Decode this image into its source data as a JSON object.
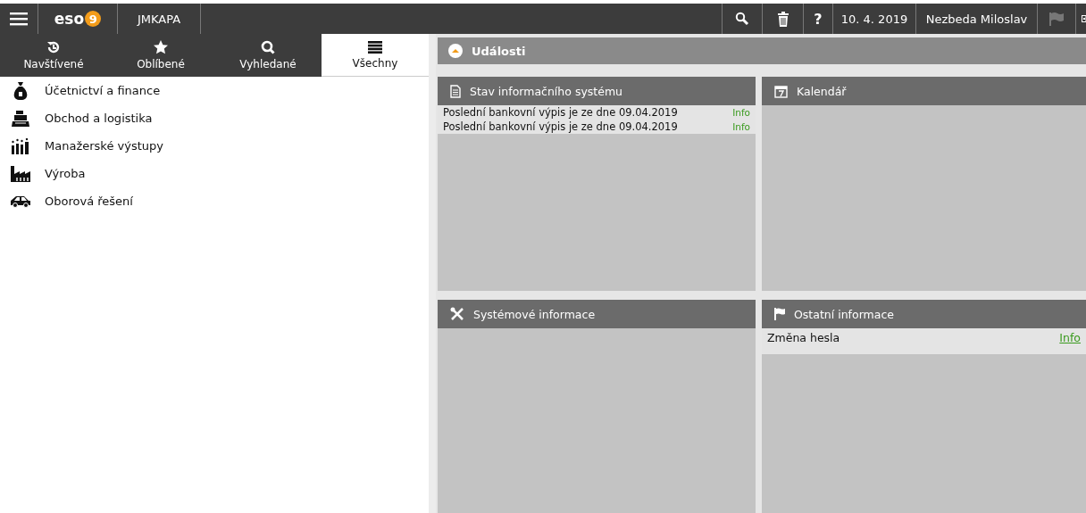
{
  "topbar": {
    "logo": {
      "text": "eso",
      "badge": "9"
    },
    "company": "JMKAPA",
    "help": "?",
    "date": "10. 4. 2019",
    "user": "Nezbeda Miloslav"
  },
  "tabs": [
    {
      "label": "Navštívené",
      "selected": false
    },
    {
      "label": "Oblíbené",
      "selected": false
    },
    {
      "label": "Vyhledané",
      "selected": false
    },
    {
      "label": "Všechny",
      "selected": true
    }
  ],
  "menu": [
    {
      "label": "Účetnictví a finance"
    },
    {
      "label": "Obchod a logistika"
    },
    {
      "label": "Manažerské výstupy"
    },
    {
      "label": "Výroba"
    },
    {
      "label": "Oborová řešení"
    }
  ],
  "events": {
    "title": "Události",
    "expanded": true
  },
  "panels": [
    {
      "title": "Stav informačního systému",
      "rows": [
        {
          "text": "Poslední bankovní výpis je ze dne 09.04.2019",
          "link": "Info",
          "underlined": false
        },
        {
          "text": "Poslední bankovní výpis je ze dne 09.04.2019",
          "link": "Info",
          "underlined": false
        }
      ]
    },
    {
      "title": "Kalendář"
    },
    {
      "title": "Systémové informace"
    },
    {
      "title": "Ostatní informace",
      "rows": [
        {
          "text": "Změna hesla",
          "link": "Info",
          "underlined": true
        }
      ]
    }
  ]
}
